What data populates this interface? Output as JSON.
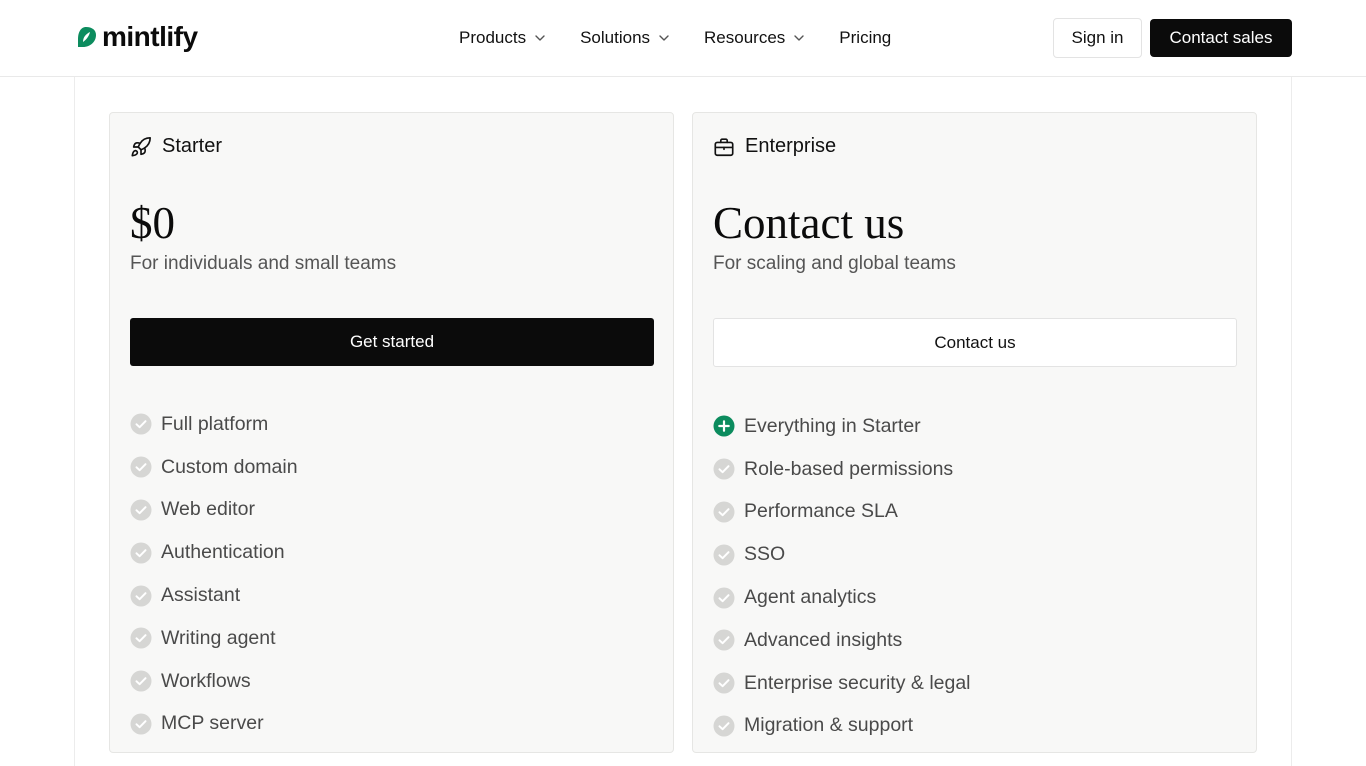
{
  "brand": {
    "name": "mintlify",
    "accent": "#0c8c5e"
  },
  "nav": {
    "items": [
      {
        "label": "Products",
        "icon": "chevron-down-icon"
      },
      {
        "label": "Solutions",
        "icon": "chevron-down-icon"
      },
      {
        "label": "Resources",
        "icon": "chevron-down-icon"
      },
      {
        "label": "Pricing"
      }
    ]
  },
  "header_actions": {
    "sign_in": "Sign in",
    "contact_sales": "Contact sales"
  },
  "plans": [
    {
      "name": "Starter",
      "icon": "rocket-icon",
      "price": "$0",
      "tagline": "For individuals and small teams",
      "cta": "Get started",
      "features": [
        {
          "label": "Full platform",
          "icon": "check-circle-icon"
        },
        {
          "label": "Custom domain",
          "icon": "check-circle-icon"
        },
        {
          "label": "Web editor",
          "icon": "check-circle-icon"
        },
        {
          "label": "Authentication",
          "icon": "check-circle-icon"
        },
        {
          "label": "Assistant",
          "icon": "check-circle-icon"
        },
        {
          "label": "Writing agent",
          "icon": "check-circle-icon"
        },
        {
          "label": "Workflows",
          "icon": "check-circle-icon"
        },
        {
          "label": "MCP server",
          "icon": "check-circle-icon"
        }
      ]
    },
    {
      "name": "Enterprise",
      "icon": "briefcase-icon",
      "price": "Contact us",
      "tagline": "For scaling and global teams",
      "cta": "Contact us",
      "features": [
        {
          "label": "Everything in Starter",
          "icon": "plus-circle-icon"
        },
        {
          "label": "Role-based permissions",
          "icon": "check-circle-icon"
        },
        {
          "label": "Performance SLA",
          "icon": "check-circle-icon"
        },
        {
          "label": "SSO",
          "icon": "check-circle-icon"
        },
        {
          "label": "Agent analytics",
          "icon": "check-circle-icon"
        },
        {
          "label": "Advanced insights",
          "icon": "check-circle-icon"
        },
        {
          "label": "Enterprise security & legal",
          "icon": "check-circle-icon"
        },
        {
          "label": "Migration & support",
          "icon": "check-circle-icon"
        }
      ]
    }
  ]
}
